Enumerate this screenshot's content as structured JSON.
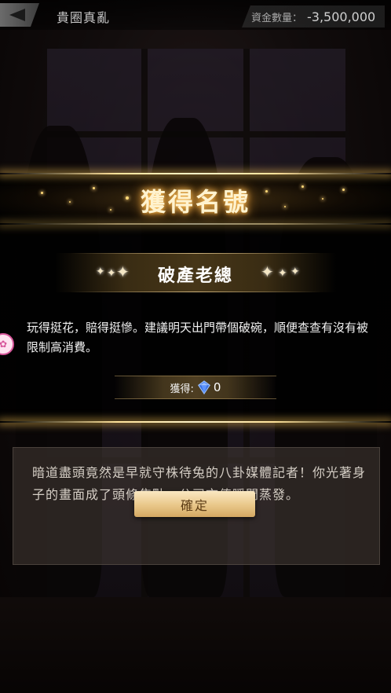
{
  "header": {
    "title": "貴圈真亂",
    "funds_label": "資金數量：",
    "funds_value": "-3,500,000"
  },
  "story": {
    "text": "暗道盡頭竟然是早就守株待兔的八卦媒體記者！你光著身子的畫面成了頭條焦點，公司市值瞬間蒸發。"
  },
  "popup": {
    "banner_title": "獲得名號",
    "title_name": "破產老總",
    "description": "玩得挺花，賠得挺慘。建議明天出門帶個破碗，順便查查有沒有被限制高消費。",
    "reward_label": "獲得:",
    "reward_value": "0",
    "reward_icon": "blue-gem-icon"
  },
  "confirm_button": {
    "label": "確定"
  },
  "colors": {
    "gold_glow": "#ffc861",
    "button_top": "#fae8c2",
    "button_bottom": "#d4a862",
    "button_text": "#5b3b14"
  }
}
